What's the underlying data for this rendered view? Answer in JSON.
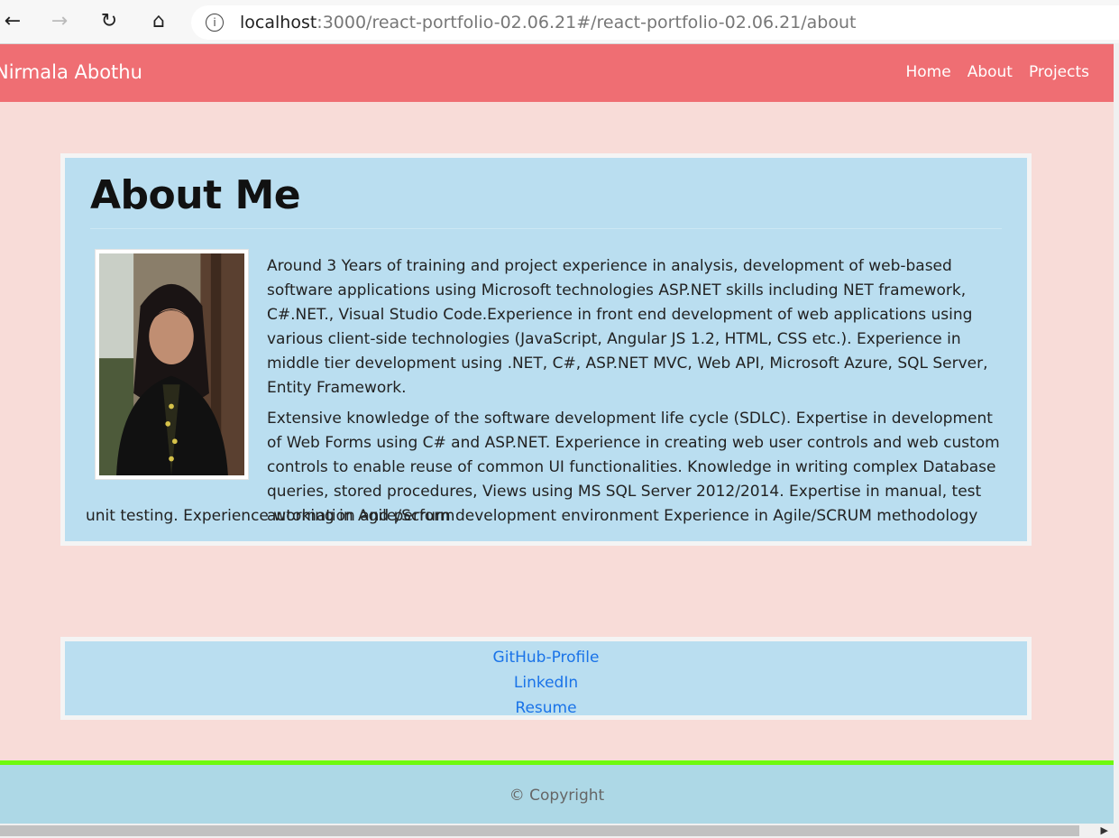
{
  "browser": {
    "url_host": "localhost",
    "url_rest": ":3000/react-portfolio-02.06.21#/react-portfolio-02.06.21/about",
    "icons": [
      "back-arrow-icon",
      "forward-arrow-icon",
      "reload-icon",
      "home-icon",
      "info-icon"
    ]
  },
  "navbar": {
    "brand": "Nirmala Abothu",
    "links": [
      "Home",
      "About",
      "Projects"
    ],
    "background": "#ef6e73"
  },
  "about": {
    "title": "About Me",
    "paragraph1": "Around 3 Years of training and project experience in analysis, development of web-based software applications using Microsoft technologies ASP.NET skills including NET framework, C#.NET., Visual Studio Code.Experience in front end development of web applications using various client-side technologies (JavaScript, Angular JS 1.2, HTML, CSS etc.). Experience in middle tier development using .NET, C#, ASP.NET MVC, Web API, Microsoft Azure, SQL Server, Entity Framework.",
    "paragraph2": "Extensive knowledge of the software development life cycle (SDLC). Expertise in development of Web Forms using C# and ASP.NET. Experience in creating web user controls and web custom controls to enable reuse of common UI functionalities. Knowledge in writing complex Database queries, stored procedures, Views using MS SQL Server 2012/2014. Expertise in manual, test automation and perform",
    "paragraph2_tail": "unit testing. Experience working in Agile/Scrum development environment Experience in Agile/SCRUM methodology"
  },
  "links": [
    "GitHub-Profile",
    "LinkedIn",
    "Resume"
  ],
  "footer": {
    "text": "© Copyright",
    "border_color": "#6ef90f"
  },
  "colors": {
    "page_bg": "#f8dcd8",
    "card_bg": "#badef0",
    "link": "#1a73e8",
    "footer_bg": "#add8e6"
  }
}
